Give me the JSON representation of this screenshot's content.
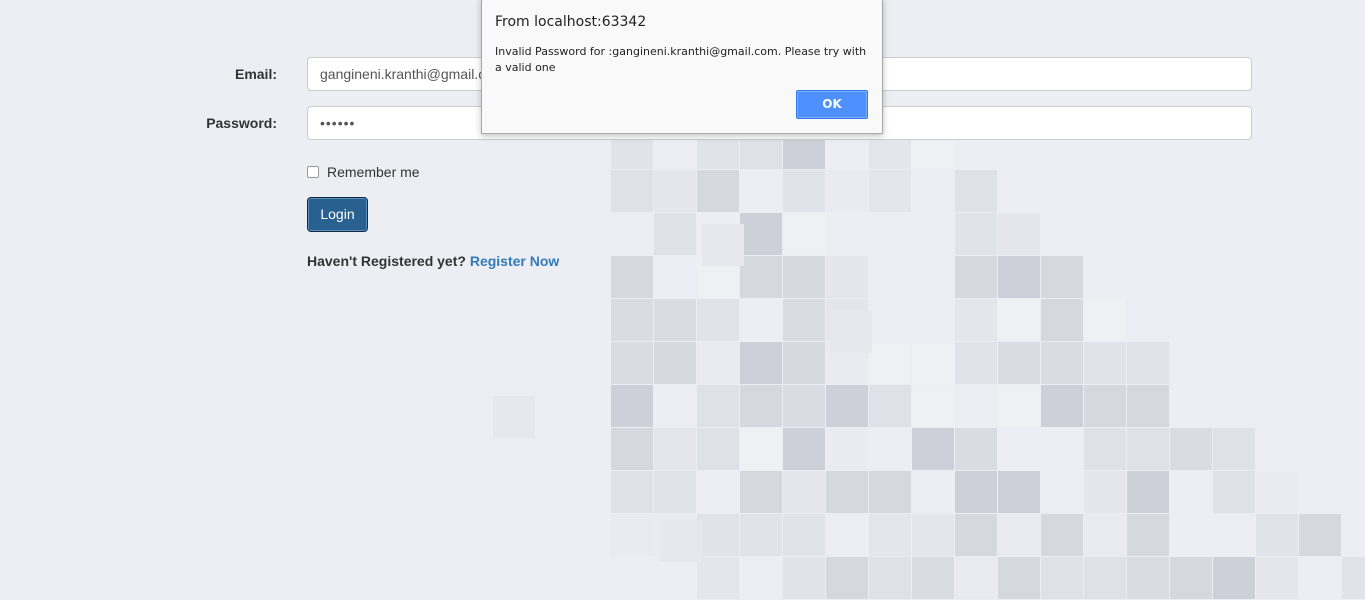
{
  "form": {
    "email_label": "Email:",
    "email_value": "gangineni.kranthi@gmail.com",
    "password_label": "Password:",
    "password_value": "••••••",
    "remember_label": "Remember me",
    "login_label": "Login",
    "register_prompt": "Haven't Registered yet?",
    "register_link": "Register Now"
  },
  "dialog": {
    "title": "From localhost:63342",
    "message": "Invalid Password for :gangineni.kranthi@gmail.com. Please try with a valid one",
    "ok_label": "OK"
  },
  "colors": {
    "primary_button": "#286090",
    "link": "#337ab7",
    "dialog_ok": "#4d90fe"
  }
}
